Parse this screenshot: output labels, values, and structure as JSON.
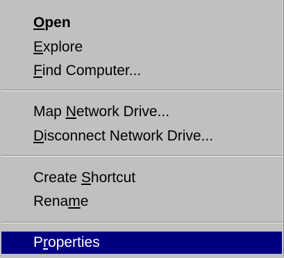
{
  "context_menu": {
    "items": [
      {
        "pre": "",
        "u": "O",
        "post": "pen"
      },
      {
        "pre": "",
        "u": "E",
        "post": "xplore"
      },
      {
        "pre": "",
        "u": "F",
        "post": "ind Computer..."
      },
      {
        "pre": "Map ",
        "u": "N",
        "post": "etwork Drive..."
      },
      {
        "pre": "",
        "u": "D",
        "post": "isconnect Network Drive..."
      },
      {
        "pre": "Create ",
        "u": "S",
        "post": "hortcut"
      },
      {
        "pre": "Rena",
        "u": "m",
        "post": "e"
      },
      {
        "pre": "P",
        "u": "r",
        "post": "operties"
      }
    ],
    "selection_color": "#000080",
    "menu_background": "#c0c0c0"
  }
}
